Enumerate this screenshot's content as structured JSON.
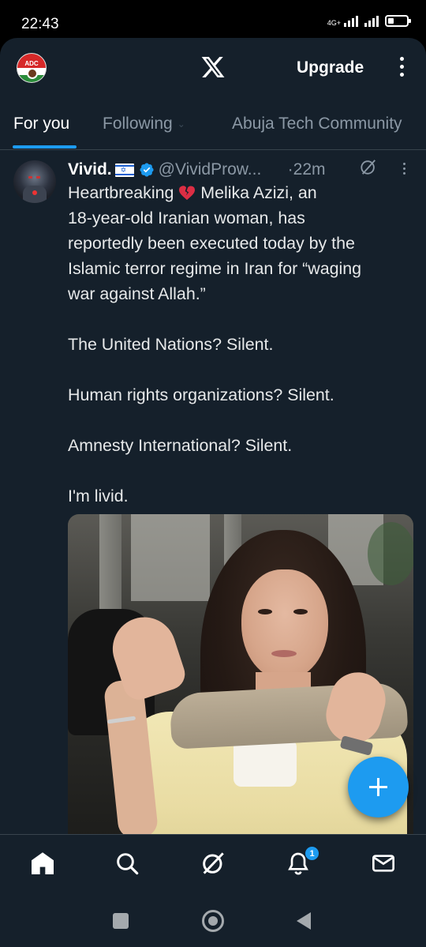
{
  "status_bar": {
    "time": "22:43",
    "network": "4G+",
    "battery_level": 0.3
  },
  "header": {
    "logo_text": "ADC",
    "brand_icon": "x-logo-icon",
    "upgrade_label": "Upgrade",
    "more_icon": "more-vertical-icon"
  },
  "tabs": [
    {
      "label": "For you",
      "active": true
    },
    {
      "label": "Following",
      "active": false
    },
    {
      "label": "Abuja Tech Community",
      "active": false
    }
  ],
  "tweet": {
    "display_name": "Vivid.",
    "flag": "Israel flag",
    "verified": true,
    "handle": "@VividProw...",
    "separator": "·",
    "time": "22m",
    "body_line1_prefix": "Heartbreaking ",
    "body_line1_suffix": " Melika Azizi, an",
    "body_rest": "18-year-old Iranian woman, has\nreportedly been executed today by the\nIslamic terror regime in Iran for “waging\nwar against Allah.”\n\nThe United Nations? Silent.\n\nHuman rights organizations? Silent.\n\nAmnesty International? Silent.\n\nI'm livid.",
    "emoji": "broken-heart-icon"
  },
  "compose": {
    "icon": "plus-icon"
  },
  "bottom_nav": {
    "items": [
      "home-icon",
      "search-icon",
      "grok-icon",
      "notifications-icon",
      "messages-icon"
    ],
    "notification_count": "1"
  },
  "colors": {
    "background": "#15202b",
    "accent": "#1d9bf0",
    "muted_text": "#8b98a5",
    "divider": "#38444d"
  }
}
